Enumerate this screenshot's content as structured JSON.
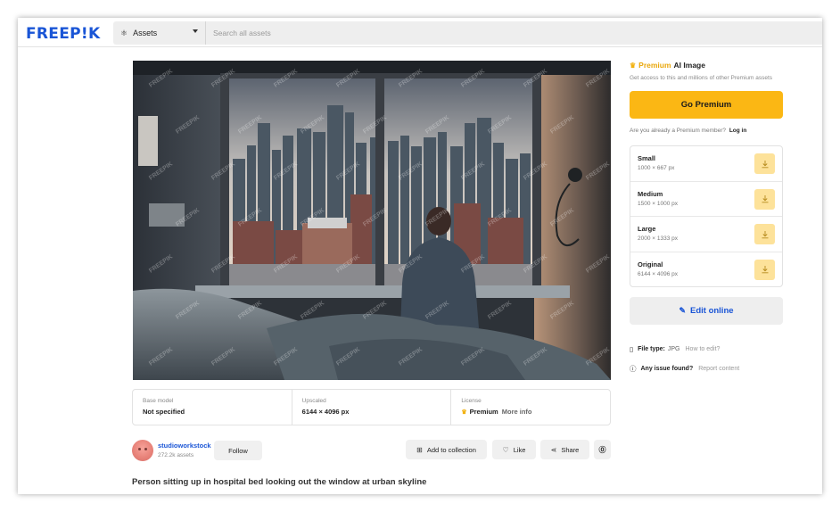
{
  "header": {
    "logo": "FREEP!K",
    "assets_label": "Assets",
    "search_placeholder": "Search all assets"
  },
  "image": {
    "watermark": "FREEPIK"
  },
  "info": {
    "base_model_label": "Base model",
    "base_model_value": "Not specified",
    "upscaled_label": "Upscaled",
    "upscaled_value": "6144 × 4096 px",
    "license_label": "License",
    "license_value": "Premium",
    "license_link": "More info"
  },
  "author": {
    "name": "studioworkstock",
    "assets": "272.2k assets",
    "follow_label": "Follow"
  },
  "actions": {
    "add_collection": "Add to collection",
    "like": "Like",
    "share": "Share"
  },
  "caption": "Person sitting up in hospital bed looking out the window at urban skyline",
  "premium": {
    "badge": "Premium",
    "title": "AI Image",
    "subtitle": "Get access to this and millions of other Premium assets",
    "cta": "Go Premium",
    "member_question": "Are you already a Premium member?",
    "login": "Log in"
  },
  "sizes": [
    {
      "name": "Small",
      "dims": "1000 × 667 px"
    },
    {
      "name": "Medium",
      "dims": "1500 × 1000 px"
    },
    {
      "name": "Large",
      "dims": "2000 × 1333 px"
    },
    {
      "name": "Original",
      "dims": "6144 × 4096 px"
    }
  ],
  "edit_online": "Edit online",
  "file": {
    "label": "File type:",
    "value": "JPG",
    "link": "How to edit?"
  },
  "issue": {
    "label": "Any issue found?",
    "link": "Report content"
  },
  "colors": {
    "brand_blue": "#1a55d6",
    "premium_yellow": "#fbb714",
    "download_tint": "#fde29a"
  }
}
